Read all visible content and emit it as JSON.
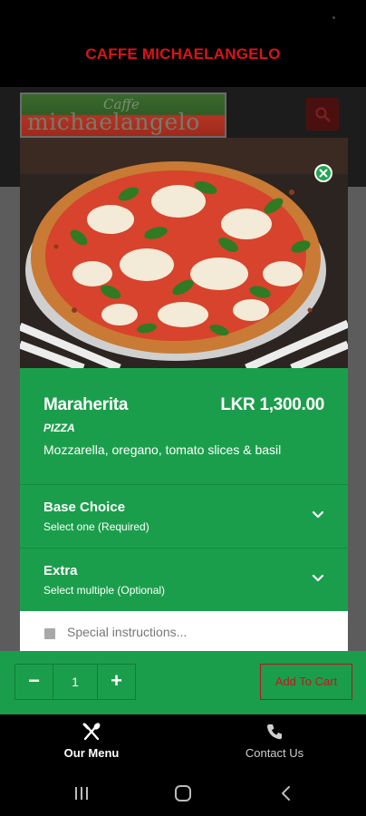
{
  "header": {
    "title": "CAFFE MICHAELANGELO"
  },
  "background_page": {
    "logo": {
      "script_text": "Caffe",
      "main_text": "michaelangelo"
    },
    "search_icon": "search-icon"
  },
  "product_modal": {
    "close_icon": "close-icon",
    "name": "Maraherita",
    "price": "LKR 1,300.00",
    "category": "PIZZA",
    "description": "Mozzarella, oregano, tomato slices & basil",
    "options": [
      {
        "title": "Base Choice",
        "subtitle": "Select one (Required)",
        "icon": "chevron-down-icon"
      },
      {
        "title": "Extra",
        "subtitle": "Select multiple (Optional)",
        "icon": "chevron-down-icon"
      }
    ],
    "instructions_placeholder": "Special instructions..."
  },
  "cart": {
    "minus_label": "−",
    "quantity": "1",
    "plus_label": "+",
    "add_to_cart_label": "Add To Cart"
  },
  "bottom_nav": {
    "items": [
      {
        "label": "Our Menu",
        "icon": "fork-knife-icon",
        "active": true
      },
      {
        "label": "Contact Us",
        "icon": "phone-icon",
        "active": false
      }
    ]
  },
  "system_nav": {
    "icons": [
      "recent-apps-icon",
      "home-icon",
      "back-icon"
    ]
  },
  "colors": {
    "brand_green": "#1b9e4b",
    "brand_red": "#d8141b",
    "background": "#000000"
  }
}
